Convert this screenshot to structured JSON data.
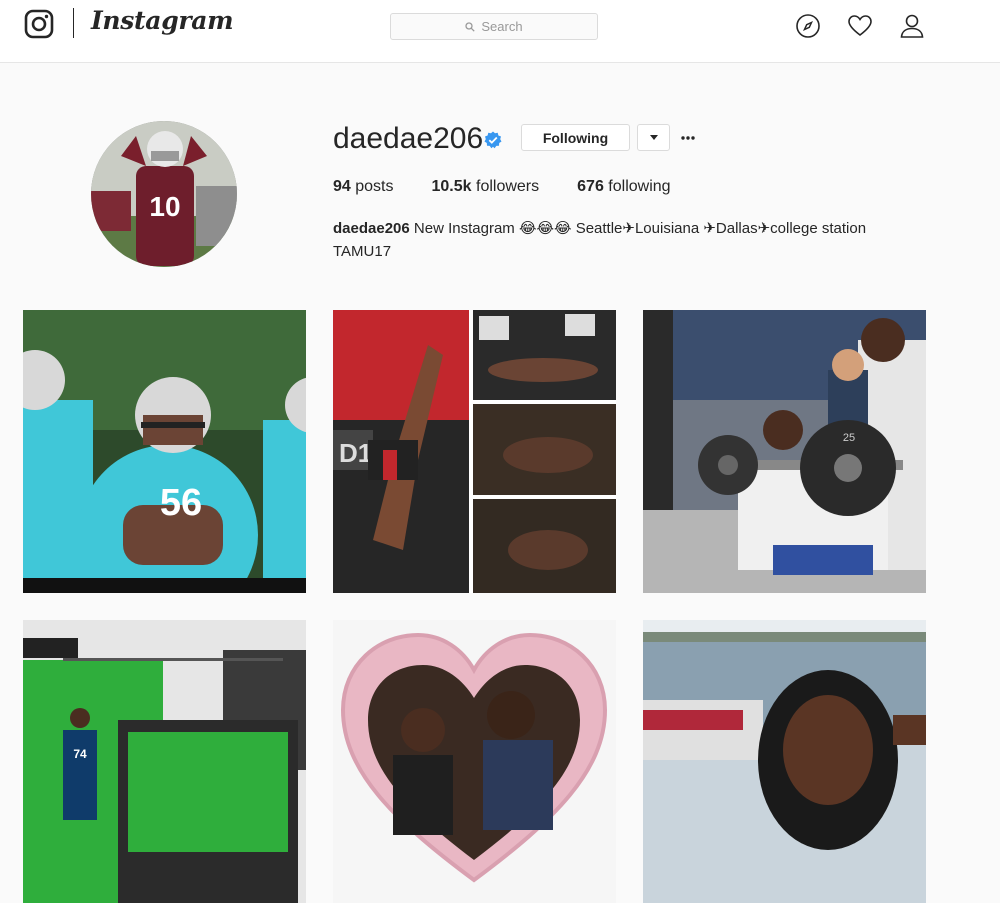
{
  "nav": {
    "wordmark": "Instagram",
    "search_placeholder": "Search"
  },
  "profile": {
    "username": "daedae206",
    "verified": true,
    "following_label": "Following",
    "stats": {
      "posts_count": "94",
      "posts_label": "posts",
      "followers_count": "10.5k",
      "followers_label": "followers",
      "following_count": "676",
      "following_label": "following"
    },
    "bio": {
      "name": "daedae206",
      "line1": "New Instagram 😂😂😂 Seattle✈Louisiana ✈Dallas✈college station",
      "line2": "TAMU17"
    },
    "avatar_jersey": "10"
  },
  "posts": [
    {
      "jersey": "56",
      "subject": "football players in teal jerseys"
    },
    {
      "sign": "D1",
      "subject": "workout collage"
    },
    {
      "plate": "25",
      "subject": "weight room squat"
    },
    {
      "jersey": "74",
      "subject": "green screen studio"
    },
    {
      "subject": "heart frame group photo"
    },
    {
      "subject": "boat selfie on lake"
    }
  ],
  "colors": {
    "accent": "#3897f0",
    "text": "#262626",
    "border": "#dbdbdb",
    "background": "#fafafa"
  },
  "icons": [
    "instagram-logo-icon",
    "search-icon",
    "compass-icon",
    "heart-icon",
    "user-icon",
    "verified-badge-icon",
    "caret-down-icon",
    "more-icon"
  ]
}
